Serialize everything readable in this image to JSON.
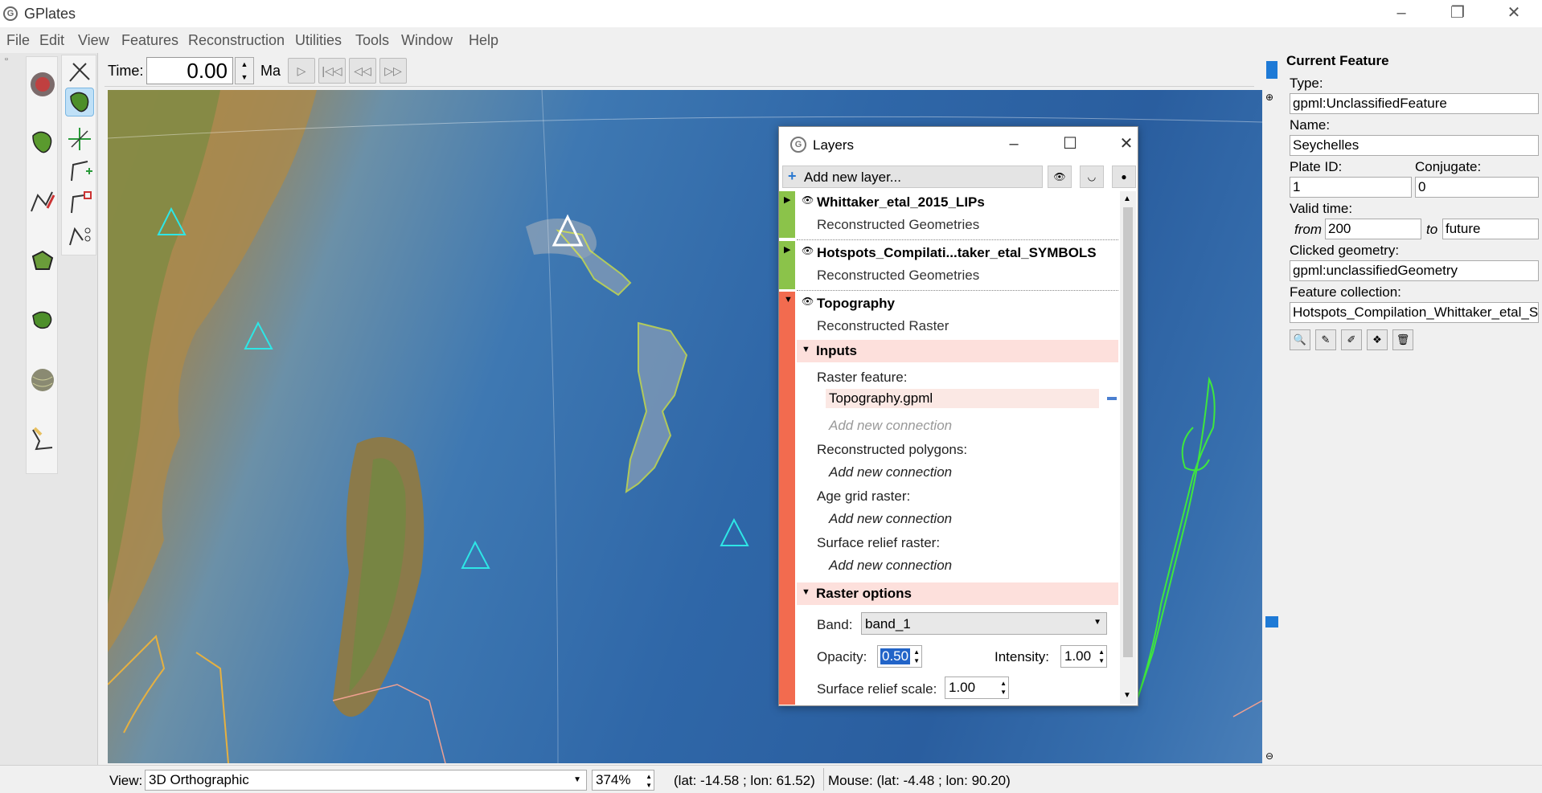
{
  "app": {
    "title": "GPlates"
  },
  "menu": [
    "File",
    "Edit",
    "View",
    "Features",
    "Reconstruction",
    "Utilities",
    "Tools",
    "Window",
    "Help"
  ],
  "time": {
    "label": "Time:",
    "value": "0.00",
    "unit": "Ma"
  },
  "layers_window": {
    "title": "Layers",
    "add_layer": "Add new layer...",
    "layers": [
      {
        "name": "Whittaker_etal_2015_LIPs",
        "type": "Reconstructed Geometries",
        "color": "#8bc34a"
      },
      {
        "name": "Hotspots_Compilati...taker_etal_SYMBOLS",
        "type": "Reconstructed Geometries",
        "color": "#8bc34a"
      },
      {
        "name": "Topography",
        "type": "Reconstructed Raster",
        "color": "#f26b4f"
      }
    ],
    "inputs": {
      "heading": "Inputs",
      "raster_feature_label": "Raster feature:",
      "raster_feature_value": "Topography.gpml",
      "add_new_connection_dim": "Add new connection",
      "reconstructed_polygons_label": "Reconstructed polygons:",
      "age_grid_label": "Age grid raster:",
      "surface_relief_label": "Surface relief raster:",
      "add_new_connection": "Add new connection"
    },
    "raster_options": {
      "heading": "Raster options",
      "band_label": "Band:",
      "band_value": "band_1",
      "opacity_label": "Opacity:",
      "opacity_value": "0.50",
      "intensity_label": "Intensity:",
      "intensity_value": "1.00",
      "relief_label": "Surface relief scale:",
      "relief_value": "1.00"
    }
  },
  "current_feature": {
    "title": "Current Feature",
    "type_label": "Type:",
    "type_value": "gpml:UnclassifiedFeature",
    "name_label": "Name:",
    "name_value": "Seychelles",
    "plate_id_label": "Plate ID:",
    "plate_id_value": "1",
    "conjugate_label": "Conjugate:",
    "conjugate_value": "0",
    "valid_time_label": "Valid time:",
    "from_label": "from",
    "from_value": "200",
    "to_label": "to",
    "to_value": "future",
    "clicked_geometry_label": "Clicked geometry:",
    "clicked_geometry_value": "gpml:unclassifiedGeometry",
    "feature_collection_label": "Feature collection:",
    "feature_collection_value": "Hotspots_Compilation_Whittaker_etal_SY"
  },
  "status": {
    "view_label": "View:",
    "view_value": "3D Orthographic",
    "zoom_value": "374%",
    "camera": "(lat: -14.58 ; lon: 61.52)",
    "mouse": "Mouse: (lat: -4.48 ; lon: 90.20)"
  }
}
